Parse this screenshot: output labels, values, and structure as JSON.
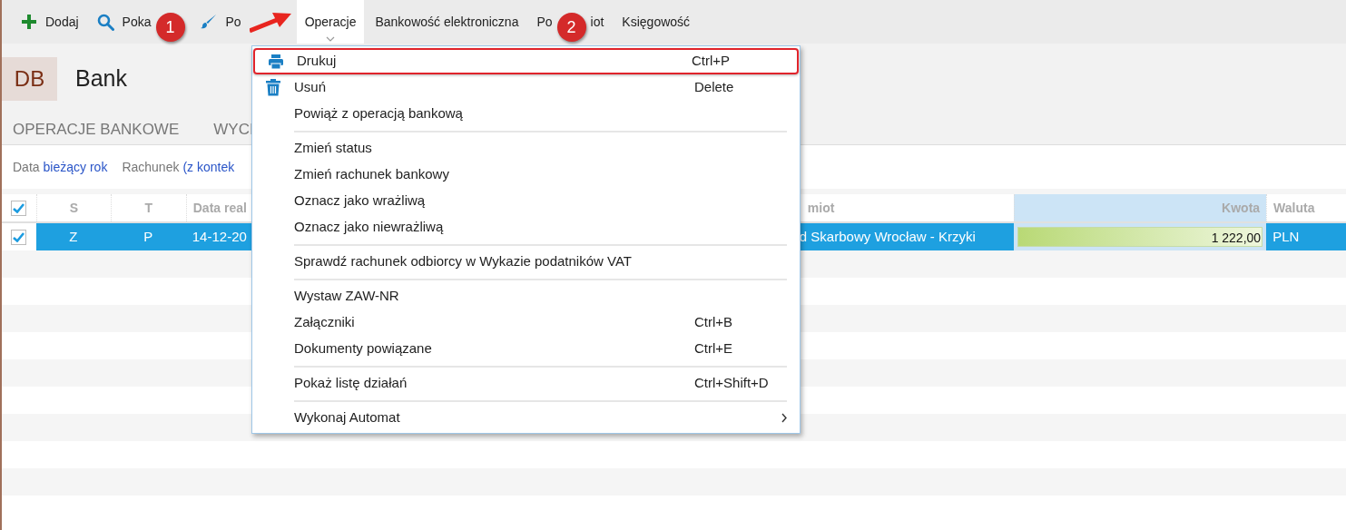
{
  "toolbar": [
    {
      "label_parts": [
        "Dodaj"
      ],
      "selected": false
    },
    {
      "label_parts": [
        "Poka"
      ],
      "annotation": "1",
      "selected": false
    },
    {
      "label_parts": [
        "Po"
      ],
      "selected": false
    },
    {
      "label_parts": [
        "Operacje"
      ],
      "selected": true
    },
    {
      "label_parts": [
        "Bankowość elektroniczna"
      ],
      "selected": false
    },
    {
      "label_parts": [
        "Po",
        "iot"
      ],
      "annotation": "2",
      "selected": false
    },
    {
      "label_parts": [
        "Księgowość"
      ],
      "selected": false
    }
  ],
  "module": {
    "badge": "DB",
    "title": "Bank"
  },
  "tabs": [
    {
      "label": "OPERACJE BANKOWE",
      "selected": false
    },
    {
      "label": "WYCI",
      "selected": false
    }
  ],
  "filters": [
    {
      "label": "Data",
      "value": "bieżący rok"
    },
    {
      "label": "Rachunek",
      "value": "(z kontek"
    }
  ],
  "table": {
    "header_checked": true,
    "columns": [
      {
        "label": "S",
        "selected": false
      },
      {
        "label": "T",
        "selected": false
      },
      {
        "label": "Data real",
        "selected": false
      },
      {
        "label": "miot",
        "selected": false
      },
      {
        "label": "Kwota",
        "selected": true
      },
      {
        "label": "Waluta",
        "selected": false
      }
    ],
    "rows": [
      {
        "checked": true,
        "selected": true,
        "cells": [
          "Z",
          "P",
          "14-12-20",
          "d Skarbowy Wrocław - Krzyki",
          "1 222,00",
          "PLN"
        ],
        "level": 1
      }
    ]
  },
  "menu": {
    "items": [
      {
        "label": "Drukuj",
        "shortcut": "Ctrl+P",
        "highlighted": true,
        "separator_after": false
      },
      {
        "label": "Usuń",
        "shortcut": "Delete",
        "highlighted": false,
        "separator_after": false
      },
      {
        "label": "Powiąż z operacją bankową",
        "highlighted": false,
        "separator_after": true
      },
      {
        "label": "Zmień status",
        "highlighted": false,
        "separator_after": false
      },
      {
        "label": "Zmień rachunek bankowy",
        "highlighted": false,
        "separator_after": false
      },
      {
        "label": "Oznacz jako wrażliwą",
        "highlighted": false,
        "separator_after": false
      },
      {
        "label": "Oznacz jako niewrażliwą",
        "highlighted": false,
        "separator_after": true
      },
      {
        "label": "Sprawdź rachunek odbiorcy w Wykazie podatników VAT",
        "highlighted": false,
        "separator_after": true
      },
      {
        "label": "Wystaw ZAW-NR",
        "highlighted": false,
        "separator_after": false
      },
      {
        "label": "Załączniki",
        "shortcut": "Ctrl+B",
        "highlighted": false,
        "separator_after": false
      },
      {
        "label": "Dokumenty powiązane",
        "shortcut": "Ctrl+E",
        "highlighted": false,
        "separator_after": true
      },
      {
        "label": "Pokaż listę działań",
        "shortcut": "Ctrl+Shift+D",
        "highlighted": false,
        "separator_after": true
      },
      {
        "label": "Wykonaj Automat",
        "submenu": true,
        "highlighted": false
      }
    ]
  }
}
